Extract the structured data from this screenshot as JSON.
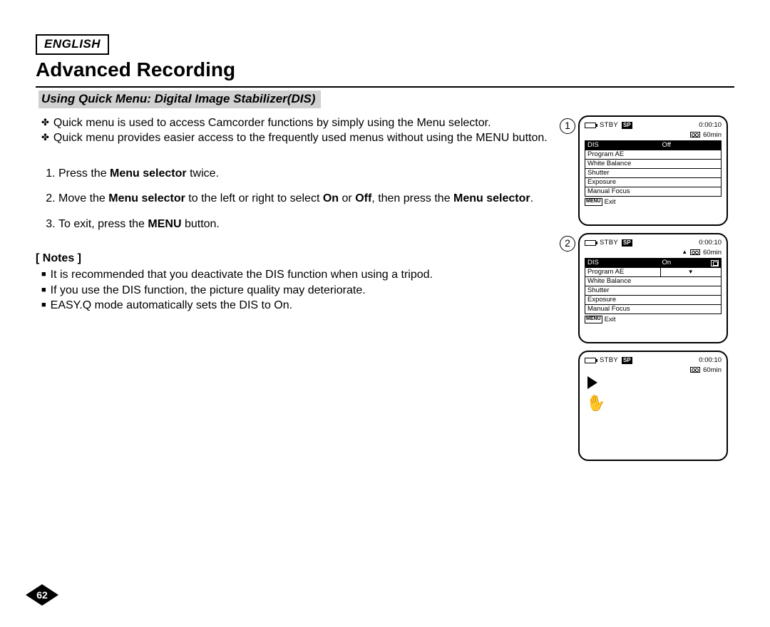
{
  "header": {
    "language": "ENGLISH",
    "title": "Advanced Recording",
    "subsection": "Using Quick Menu: Digital Image Stabilizer(DIS)"
  },
  "intro": {
    "b1": "Quick menu is used to access Camcorder functions by simply using the Menu selector.",
    "b2": "Quick menu provides easier access to the frequently used menus without using the MENU button."
  },
  "steps": {
    "s1_a": "Press the ",
    "s1_b": "Menu selector",
    "s1_c": " twice.",
    "s2_a": "Move the ",
    "s2_b": "Menu selector",
    "s2_c": " to the left or right to select ",
    "s2_d": "On",
    "s2_e": " or ",
    "s2_f": "Off",
    "s2_g": ", then press the ",
    "s2_h": "Menu selector",
    "s2_i": ".",
    "s3_a": "To exit, press the ",
    "s3_b": "MENU",
    "s3_c": " button."
  },
  "notes": {
    "heading": "[ Notes ]",
    "n1": "It is recommended that you deactivate the DIS function when using a tripod.",
    "n2": "If you use the DIS function, the picture quality may deteriorate.",
    "n3": "EASY.Q mode automatically sets the DIS to On."
  },
  "screens": {
    "circ1": "1",
    "circ2": "2",
    "common": {
      "stby": "STBY",
      "sp": "SP",
      "timecode": "0:00:10",
      "tapeTime": "60min",
      "menu_badge": "MENU",
      "exit": "Exit",
      "items": {
        "dis": "DIS",
        "programAE": "Program AE",
        "wb": "White Balance",
        "shutter": "Shutter",
        "exposure": "Exposure",
        "mf": "Manual Focus"
      }
    },
    "s1": {
      "disVal": "Off"
    },
    "s2": {
      "disVal": "On"
    }
  },
  "page": "62"
}
